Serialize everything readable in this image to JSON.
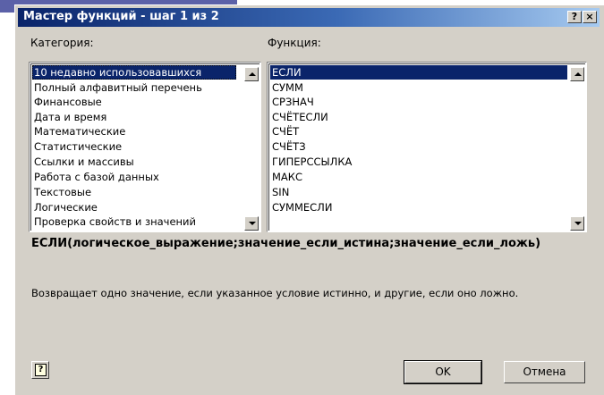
{
  "dialog": {
    "title": "Мастер функций - шаг 1 из 2",
    "help_glyph": "?",
    "close_glyph": "×"
  },
  "category": {
    "label": "Категория:",
    "items": [
      "10 недавно использовавшихся",
      "Полный алфавитный перечень",
      "Финансовые",
      "Дата и время",
      "Математические",
      "Статистические",
      "Ссылки и массивы",
      "Работа с базой данных",
      "Текстовые",
      "Логические",
      "Проверка свойств и значений"
    ],
    "selected": "10 недавно использовавшихся"
  },
  "function": {
    "label": "Функция:",
    "items": [
      "ЕСЛИ",
      "СУММ",
      "СРЗНАЧ",
      "СЧЁТЕСЛИ",
      "СЧЁТ",
      "СЧЁТЗ",
      "ГИПЕРССЫЛКА",
      "МАКС",
      "SIN",
      "СУММЕСЛИ"
    ],
    "selected": "ЕСЛИ"
  },
  "syntax": "ЕСЛИ(логическое_выражение;значение_если_истина;значение_если_ложь)",
  "description": "Возвращает одно значение, если указанное условие истинно, и другие, если оно ложно.",
  "buttons": {
    "ok": "OK",
    "cancel": "Отмена",
    "help_glyph": "?"
  },
  "colors": {
    "dialog_bg": "#d4d0c8",
    "title_start": "#0a246a",
    "title_end": "#a6caf0",
    "selection": "#0a246a",
    "slide_accent": "#5b61a8"
  }
}
